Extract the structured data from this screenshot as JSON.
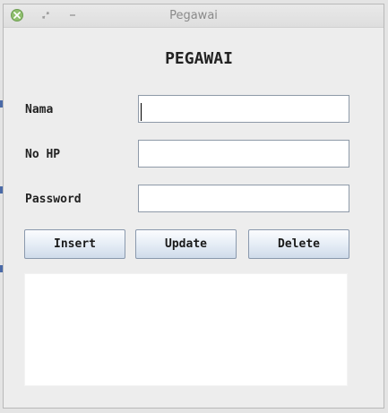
{
  "window": {
    "title": "Pegawai"
  },
  "form": {
    "heading": "PEGAWAI",
    "fields": [
      {
        "label": "Nama",
        "value": "",
        "placeholder": ""
      },
      {
        "label": "No HP",
        "value": "",
        "placeholder": ""
      },
      {
        "label": "Password",
        "value": "",
        "placeholder": ""
      }
    ],
    "buttons": {
      "insert": "Insert",
      "update": "Update",
      "delete": "Delete"
    },
    "output_text": ""
  },
  "colors": {
    "close_button": "#8fbf6e",
    "button_gradient_bottom": "#cfdbea",
    "field_border": "#8e9aa8"
  },
  "icons": [
    "close-icon",
    "restore-icon",
    "minimize-icon"
  ]
}
